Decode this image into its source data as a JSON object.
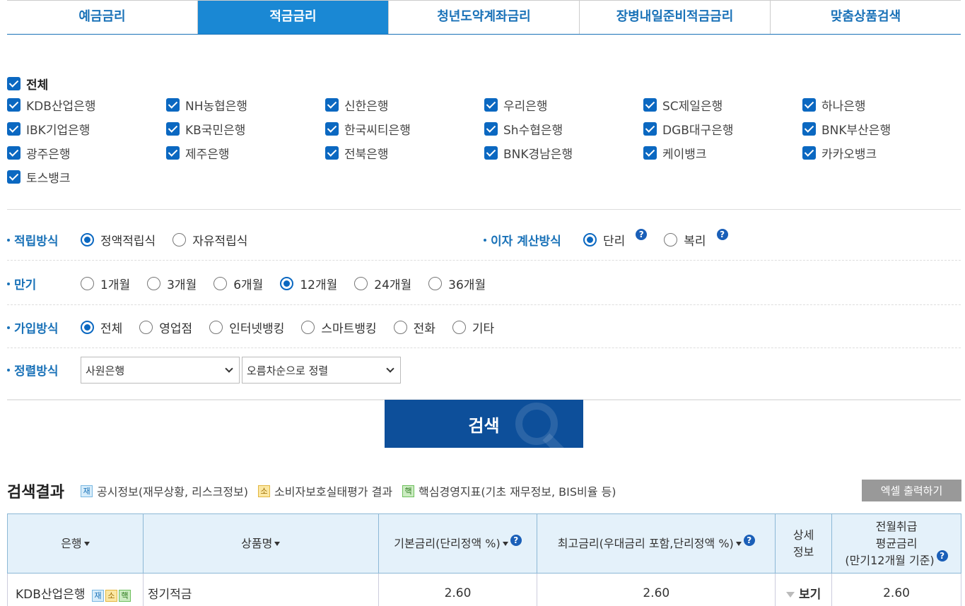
{
  "tabs": [
    {
      "label": "예금금리",
      "active": false
    },
    {
      "label": "적금금리",
      "active": true
    },
    {
      "label": "청년도약계좌금리",
      "active": false
    },
    {
      "label": "장병내일준비적금금리",
      "active": false
    },
    {
      "label": "맞춤상품검색",
      "active": false
    }
  ],
  "banks": {
    "all_label": "전체",
    "items": [
      "KDB산업은행",
      "NH농협은행",
      "신한은행",
      "우리은행",
      "SC제일은행",
      "하나은행",
      "IBK기업은행",
      "KB국민은행",
      "한국씨티은행",
      "Sh수협은행",
      "DGB대구은행",
      "BNK부산은행",
      "광주은행",
      "제주은행",
      "전북은행",
      "BNK경남은행",
      "케이뱅크",
      "카카오뱅크",
      "토스뱅크"
    ]
  },
  "options": {
    "deposit_method": {
      "label": "적립방식",
      "choices": [
        "정액적립식",
        "자유적립식"
      ],
      "selected": "정액적립식"
    },
    "interest_method": {
      "label": "이자 계산방식",
      "choices": [
        "단리",
        "복리"
      ],
      "selected": "단리",
      "help": "?"
    },
    "term": {
      "label": "만기",
      "choices": [
        "1개월",
        "3개월",
        "6개월",
        "12개월",
        "24개월",
        "36개월"
      ],
      "selected": "12개월"
    },
    "join_method": {
      "label": "가입방식",
      "choices": [
        "전체",
        "영업점",
        "인터넷뱅킹",
        "스마트뱅킹",
        "전화",
        "기타"
      ],
      "selected": "전체"
    },
    "sort": {
      "label": "정렬방식",
      "sort_by": "사원은행",
      "order": "오름차순으로 정렬"
    }
  },
  "search_button": "검색",
  "results": {
    "title": "검색결과",
    "legend": [
      {
        "badge": "재",
        "text": "공시정보(재무상황, 리스크정보)",
        "color": "#1a72b8"
      },
      {
        "badge": "소",
        "text": "소비자보호실태평가 결과",
        "color": "#e2b640"
      },
      {
        "badge": "핵",
        "text": "핵심경영지표(기초 재무정보, BIS비율 등)",
        "color": "#6dbf5c"
      }
    ],
    "excel_button": "엑셀 출력하기",
    "headers": {
      "bank": "은행",
      "product": "상품명",
      "base_rate": "기본금리(단리정액 %)",
      "max_rate": "최고금리(우대금리 포함,단리정액 %)",
      "detail_line1": "상세",
      "detail_line2": "정보",
      "avg_line1": "전월취급",
      "avg_line2": "평균금리",
      "avg_line3": "(만기12개월 기준)"
    },
    "rows": [
      {
        "bank": "KDB산업은행",
        "badges": [
          "재",
          "소",
          "핵"
        ],
        "product": "정기적금",
        "base_rate": "2.60",
        "max_rate": "2.60",
        "detail": "보기",
        "avg_rate": "2.60"
      }
    ]
  }
}
